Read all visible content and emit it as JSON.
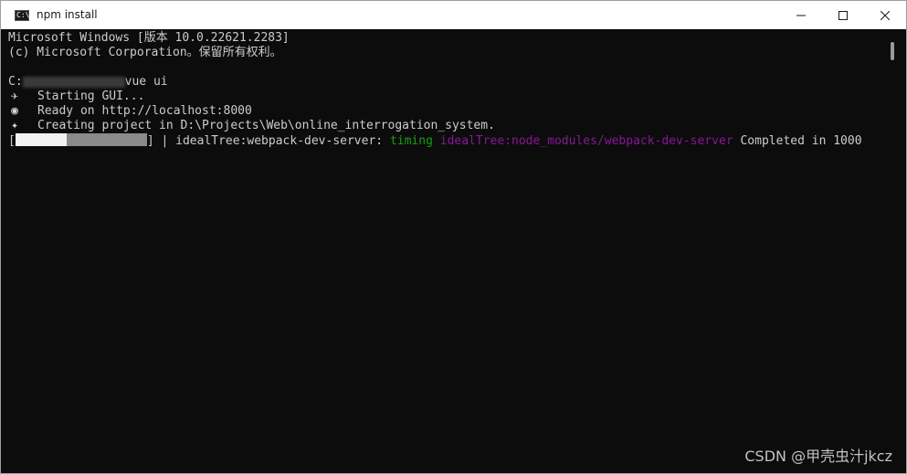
{
  "window": {
    "title": "npm install",
    "app_icon": "terminal-icon",
    "app_icon_glyph": "C:\\",
    "controls": {
      "minimize_icon": "minimize-icon",
      "maximize_icon": "maximize-icon",
      "close_icon": "close-icon"
    }
  },
  "terminal": {
    "header_line1": "Microsoft Windows [版本 10.0.22621.2283]",
    "header_line2": "(c) Microsoft Corporation。保留所有权利。",
    "prompt_prefix": "C:",
    "prompt_command": "vue ui",
    "starting_icon": "rocket-icon",
    "starting_icon_glyph": "✈",
    "starting_text": "Starting GUI...",
    "ready_icon": "globe-icon",
    "ready_icon_glyph": "◉",
    "ready_text": "Ready on http://localhost:8000",
    "creating_icon": "sparkles-icon",
    "creating_icon_glyph": "✦",
    "creating_text": "Creating project in D:\\Projects\\Web\\online_interrogation_system.",
    "progress": {
      "open_bracket": "[",
      "close_bracket": "] | ",
      "fraction": 0.39,
      "task": "idealTree:webpack-dev-server: ",
      "status": "timing",
      "detail": " idealTree:node_modules/webpack-dev-server",
      "suffix": " Completed in 1000"
    }
  },
  "watermark": "CSDN @甲壳虫汁jkcz",
  "colors": {
    "terminal_bg": "#0c0c0c",
    "terminal_fg": "#cccccc",
    "timing_green": "#13a10e",
    "detail_purple": "#881798"
  }
}
